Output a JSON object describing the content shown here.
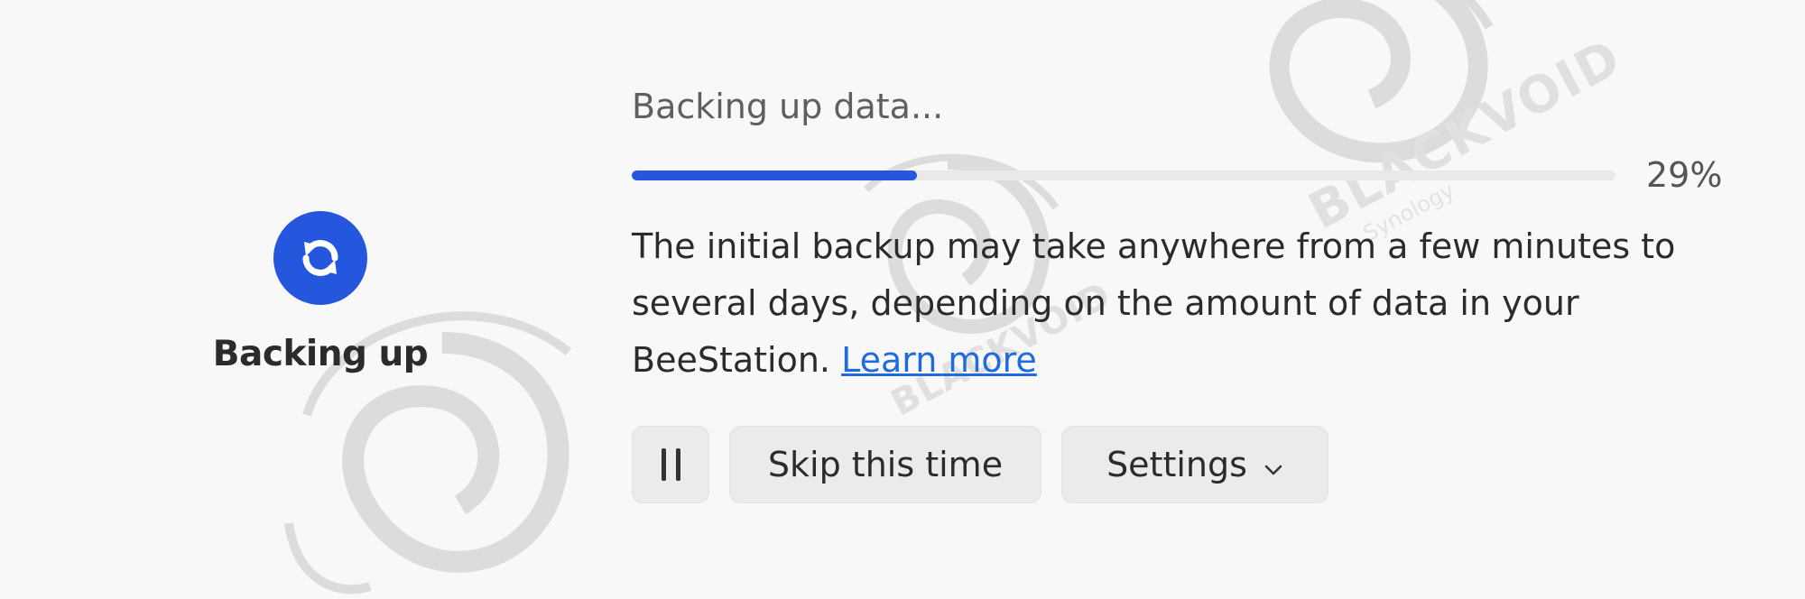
{
  "status": {
    "label": "Backing up",
    "icon": "sync-icon",
    "icon_color": "#2457de"
  },
  "progress": {
    "title": "Backing up data...",
    "percent_text": "29%",
    "value": 0.29,
    "color": "#2457de"
  },
  "description": {
    "text": "The initial backup may take anywhere from a few minutes to several days, depending on the amount of data in your BeeStation. ",
    "link_text": "Learn more"
  },
  "actions": {
    "pause_icon": "pause-icon",
    "skip_label": "Skip this time",
    "settings_label": "Settings",
    "settings_icon": "chevron-down-icon"
  },
  "watermark": {
    "brand": "BLACKVOID",
    "sub": "Synology"
  }
}
